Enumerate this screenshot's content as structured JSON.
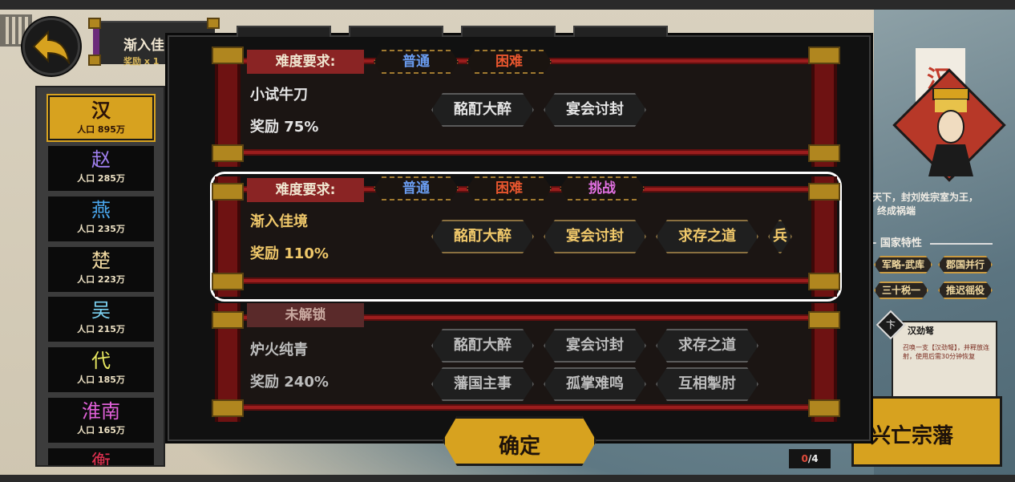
{
  "header": {
    "title": "渐入佳",
    "subtitle": "奖励 x 1"
  },
  "factions": [
    {
      "name": "汉",
      "pop": "人口 895万",
      "color": "#2b1308"
    },
    {
      "name": "赵",
      "pop": "人口 285万",
      "color": "#a080f0"
    },
    {
      "name": "燕",
      "pop": "人口 235万",
      "color": "#4aa8f0"
    },
    {
      "name": "楚",
      "pop": "人口 223万",
      "color": "#f0d8a0"
    },
    {
      "name": "吴",
      "pop": "人口 215万",
      "color": "#7ad0f0"
    },
    {
      "name": "代",
      "pop": "人口 185万",
      "color": "#e8e860"
    },
    {
      "name": "淮南",
      "pop": "人口 165万",
      "color": "#e060d8"
    },
    {
      "name": "衡",
      "pop": "",
      "color": "#e03050"
    }
  ],
  "info": {
    "banner_char": "汉",
    "desc_line1": "天下，封刘姓宗室为王，",
    "desc_line2": "终成祸端",
    "traits_title": "国家特性",
    "traits": [
      "军略-武库",
      "郡国并行",
      "三十税一",
      "推迟徭役"
    ],
    "card_badge": "卞",
    "card_name": "汉劲弩",
    "card_text": "召唤一支【汉劲弩】，并释放连射，使用后需30分钟恢复",
    "big_button": "兴亡宗藩",
    "counter_current": "0",
    "counter_total": "/4"
  },
  "modal": {
    "rows": [
      {
        "label": "难度要求:",
        "difficulties": [
          {
            "text": "普通",
            "color": "#6a9cf0"
          },
          {
            "text": "困难",
            "color": "#e8562e"
          }
        ],
        "stage": "小试牛刀",
        "reward": "奖励  75%",
        "mods": [
          "酩酊大醉",
          "宴会讨封"
        ]
      },
      {
        "label": "难度要求:",
        "difficulties": [
          {
            "text": "普通",
            "color": "#6a9cf0"
          },
          {
            "text": "困难",
            "color": "#e8562e"
          },
          {
            "text": "挑战",
            "color": "#e070e0"
          }
        ],
        "stage": "渐入佳境",
        "reward": "奖励  110%",
        "mods": [
          "酩酊大醉",
          "宴会讨封",
          "求存之道",
          "兵"
        ]
      },
      {
        "label": "未解锁",
        "difficulties": [],
        "stage": "炉火纯青",
        "reward": "奖励  240%",
        "mods": [
          "酩酊大醉",
          "宴会讨封",
          "求存之道",
          "藩国主事",
          "孤掌难鸣",
          "互相掣肘"
        ]
      }
    ],
    "confirm": "确定"
  }
}
